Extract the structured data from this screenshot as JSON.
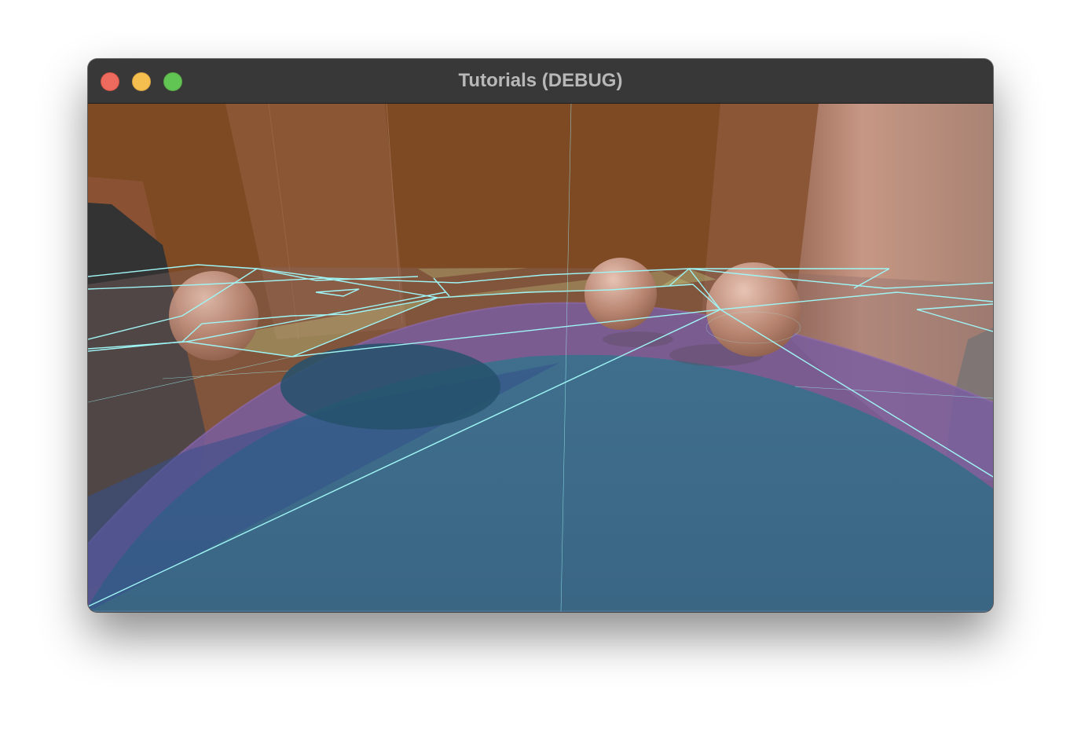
{
  "window": {
    "title": "Tutorials (DEBUG)",
    "controls": [
      "close",
      "minimize",
      "zoom"
    ]
  },
  "scene": {
    "description_icon": "3d-viewport",
    "colors": {
      "back_wall": "#7d4a24",
      "pillar": "#8a5535",
      "light_pillar": "#a88375",
      "floor_blue": "#3d6a88",
      "ring_purple": "#7a5ea0",
      "dark_block": "#323232",
      "wireframe": "#9ff5f5",
      "sphere": "#c08d7a"
    }
  }
}
